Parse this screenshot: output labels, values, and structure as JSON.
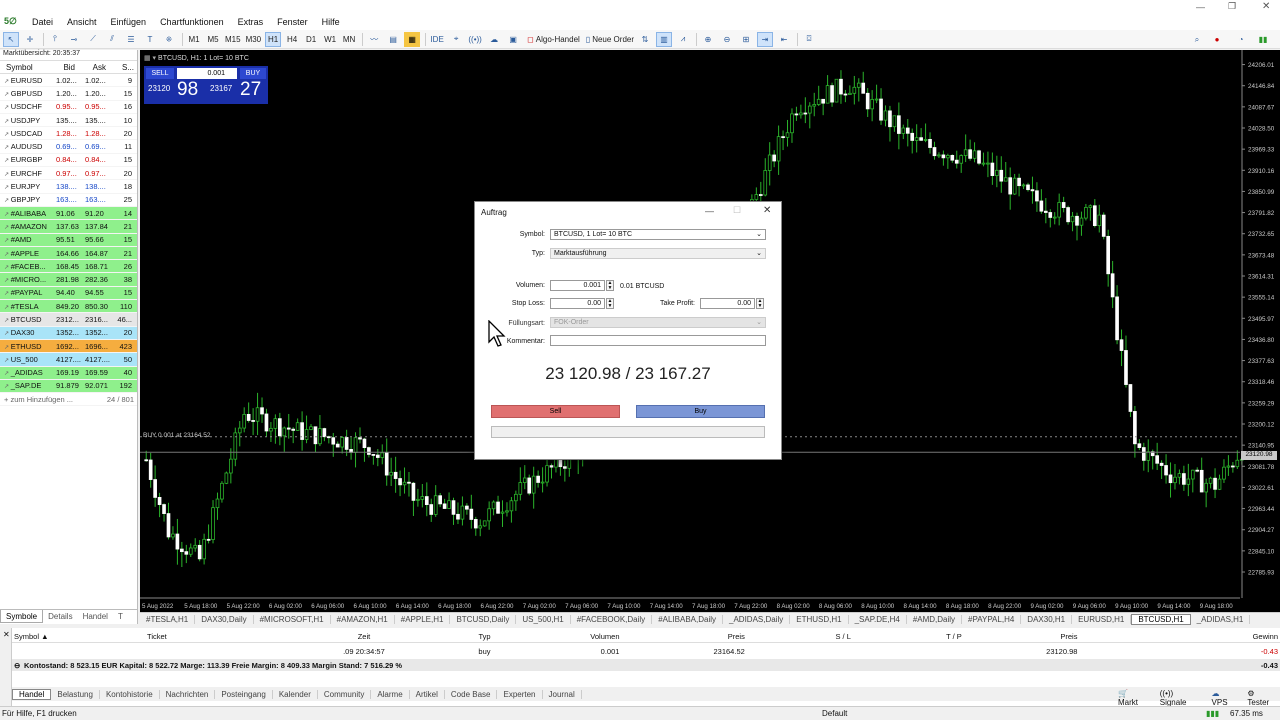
{
  "menu": [
    "Datei",
    "Ansicht",
    "Einfügen",
    "Chartfunktionen",
    "Extras",
    "Fenster",
    "Hilfe"
  ],
  "toolbar": {
    "timeframes": [
      "M1",
      "M5",
      "M15",
      "M30",
      "H1",
      "H4",
      "D1",
      "W1",
      "MN"
    ],
    "active_timeframe": "H1",
    "algo_label": "Algo-Handel",
    "new_order_label": "Neue Order"
  },
  "market_watch": {
    "title": "Marktübersicht: 20:35:37",
    "col_symbol": "Symbol",
    "col_bid": "Bid",
    "col_ask": "Ask",
    "col_spread": "S...",
    "rows": [
      {
        "symbol": "EURUSD",
        "bid": "1.02...",
        "ask": "1.02...",
        "spread": "9",
        "style": ""
      },
      {
        "symbol": "GBPUSD",
        "bid": "1.20...",
        "ask": "1.20...",
        "spread": "15",
        "style": ""
      },
      {
        "symbol": "USDCHF",
        "bid": "0.95...",
        "ask": "0.95...",
        "spread": "16",
        "style": "red"
      },
      {
        "symbol": "USDJPY",
        "bid": "135....",
        "ask": "135....",
        "spread": "10",
        "style": ""
      },
      {
        "symbol": "USDCAD",
        "bid": "1.28...",
        "ask": "1.28...",
        "spread": "20",
        "style": "red"
      },
      {
        "symbol": "AUDUSD",
        "bid": "0.69...",
        "ask": "0.69...",
        "spread": "11",
        "style": "blu"
      },
      {
        "symbol": "EURGBP",
        "bid": "0.84...",
        "ask": "0.84...",
        "spread": "15",
        "style": "red"
      },
      {
        "symbol": "EURCHF",
        "bid": "0.97...",
        "ask": "0.97...",
        "spread": "20",
        "style": "red"
      },
      {
        "symbol": "EURJPY",
        "bid": "138....",
        "ask": "138....",
        "spread": "18",
        "style": "blu"
      },
      {
        "symbol": "GBPJPY",
        "bid": "163....",
        "ask": "163....",
        "spread": "25",
        "style": "blu"
      },
      {
        "symbol": "#ALIBABA",
        "bid": "91.06",
        "ask": "91.20",
        "spread": "14",
        "style": "green"
      },
      {
        "symbol": "#AMAZON",
        "bid": "137.63",
        "ask": "137.84",
        "spread": "21",
        "style": "green"
      },
      {
        "symbol": "#AMD",
        "bid": "95.51",
        "ask": "95.66",
        "spread": "15",
        "style": "green"
      },
      {
        "symbol": "#APPLE",
        "bid": "164.66",
        "ask": "164.87",
        "spread": "21",
        "style": "green"
      },
      {
        "symbol": "#FACEB...",
        "bid": "168.45",
        "ask": "168.71",
        "spread": "26",
        "style": "green"
      },
      {
        "symbol": "#MICRO...",
        "bid": "281.98",
        "ask": "282.36",
        "spread": "38",
        "style": "green"
      },
      {
        "symbol": "#PAYPAL",
        "bid": "94.40",
        "ask": "94.55",
        "spread": "15",
        "style": "green"
      },
      {
        "symbol": "#TESLA",
        "bid": "849.20",
        "ask": "850.30",
        "spread": "110",
        "style": "green"
      },
      {
        "symbol": "BTCUSD",
        "bid": "2312...",
        "ask": "2316...",
        "spread": "46...",
        "style": "grey"
      },
      {
        "symbol": "DAX30",
        "bid": "1352...",
        "ask": "1352...",
        "spread": "20",
        "style": "blue"
      },
      {
        "symbol": "ETHUSD",
        "bid": "1692...",
        "ask": "1696...",
        "spread": "423",
        "style": "orange"
      },
      {
        "symbol": "US_500",
        "bid": "4127....",
        "ask": "4127....",
        "spread": "50",
        "style": "blue"
      },
      {
        "symbol": "_ADIDAS",
        "bid": "169.19",
        "ask": "169.59",
        "spread": "40",
        "style": "green"
      },
      {
        "symbol": "_SAP.DE",
        "bid": "91.879",
        "ask": "92.071",
        "spread": "192",
        "style": "green"
      }
    ],
    "add_label": "+ zum Hinzufügen ...",
    "count_label": "24 / 801",
    "tabs": [
      "Symbole",
      "Details",
      "Handel",
      "T"
    ]
  },
  "chart": {
    "header": "BTCUSD, H1:  1 Lot= 10 BTC",
    "sell_label": "SELL",
    "buy_label": "BUY",
    "lot_value": "0.001",
    "sell_small": "23120",
    "sell_big": "98",
    "buy_small": "23167",
    "buy_big": "27",
    "trade_line_label": "BUY 0.001 at 23164.52",
    "current_price_label": "23120.98",
    "date_labels": [
      "5 Aug 2022",
      "5 Aug 18:00",
      "5 Aug 22:00",
      "6 Aug 02:00",
      "6 Aug 06:00",
      "6 Aug 10:00",
      "6 Aug 14:00",
      "6 Aug 18:00",
      "6 Aug 22:00",
      "7 Aug 02:00",
      "7 Aug 06:00",
      "7 Aug 10:00",
      "7 Aug 14:00",
      "7 Aug 18:00",
      "7 Aug 22:00",
      "8 Aug 02:00",
      "8 Aug 06:00",
      "8 Aug 10:00",
      "8 Aug 14:00",
      "8 Aug 18:00",
      "8 Aug 22:00",
      "9 Aug 02:00",
      "9 Aug 06:00",
      "9 Aug 10:00",
      "9 Aug 14:00",
      "9 Aug 18:00"
    ],
    "tabs": [
      "#TESLA,H1",
      "DAX30,Daily",
      "#MICROSOFT,H1",
      "#AMAZON,H1",
      "#APPLE,H1",
      "BTCUSD,Daily",
      "US_500,H1",
      "#FACEBOOK,Daily",
      "#ALIBABA,Daily",
      "_ADIDAS,Daily",
      "ETHUSD,H1",
      "_SAP.DE,H4",
      "#AMD,Daily",
      "#PAYPAL,H4",
      "DAX30,H1",
      "EURUSD,H1",
      "BTCUSD,H1",
      "_ADIDAS,H1"
    ],
    "active_tab": "BTCUSD,H1"
  },
  "chart_data": {
    "type": "candlestick",
    "title": "BTCUSD, H1",
    "ylim": [
      22730,
      24230
    ],
    "y_ticks": [
      24206.01,
      24146.84,
      24087.67,
      24028.5,
      23969.33,
      23910.16,
      23850.99,
      23791.82,
      23732.65,
      23673.48,
      23614.31,
      23555.14,
      23495.97,
      23436.8,
      23377.63,
      23318.46,
      23259.29,
      23200.12,
      23140.95,
      23081.78,
      23022.61,
      22963.44,
      22904.27,
      22845.1,
      22785.93
    ],
    "current_price": 23120.98,
    "buy_entry": 23164.52
  },
  "dialog": {
    "title": "Auftrag",
    "symbol_label": "Symbol:",
    "symbol_value": "BTCUSD, 1 Lot= 10 BTC",
    "type_label": "Typ:",
    "type_value": "Marktausführung",
    "volume_label": "Volumen:",
    "volume_value": "0.001",
    "volume_unit": "0.01 BTCUSD",
    "stoploss_label": "Stop Loss:",
    "stoploss_value": "0.00",
    "takeprofit_label": "Take Profit:",
    "takeprofit_value": "0.00",
    "fill_label": "Füllungsart:",
    "fill_value": "FOK-Order",
    "comment_label": "Kommentar:",
    "comment_value": "",
    "price_display": "23 120.98 / 23 167.27",
    "sell_button": "Sell",
    "buy_button": "Buy"
  },
  "terminal": {
    "headers": {
      "symbol": "Symbol",
      "ticket": "Ticket",
      "time": "Zeit",
      "type": "Typ",
      "volume": "Volumen",
      "price": "Preis",
      "sl": "S / L",
      "tp": "T / P",
      "price2": "Preis",
      "profit": "Gewinn"
    },
    "position": {
      "time": ".09 20:34:57",
      "type": "buy",
      "volume": "0.001",
      "price": "23164.52",
      "price2": "23120.98",
      "profit": "-0.43"
    },
    "summary": "Kontostand: 8 523.15 EUR  Kapital: 8 522.72  Marge: 113.39  Freie Margin: 8 409.33  Margin Stand: 7 516.29 %",
    "summary_profit": "-0.43",
    "tabs": [
      "Handel",
      "Belastung",
      "Kontohistorie",
      "Nachrichten",
      "Posteingang",
      "Kalender",
      "Community",
      "Alarme",
      "Artikel",
      "Code Base",
      "Experten",
      "Journal"
    ],
    "right_items": [
      "Markt",
      "Signale",
      "VPS",
      "Tester"
    ]
  },
  "status": {
    "help": "Für Hilfe, F1 drucken",
    "profile": "Default",
    "ping": "67.35 ms"
  }
}
